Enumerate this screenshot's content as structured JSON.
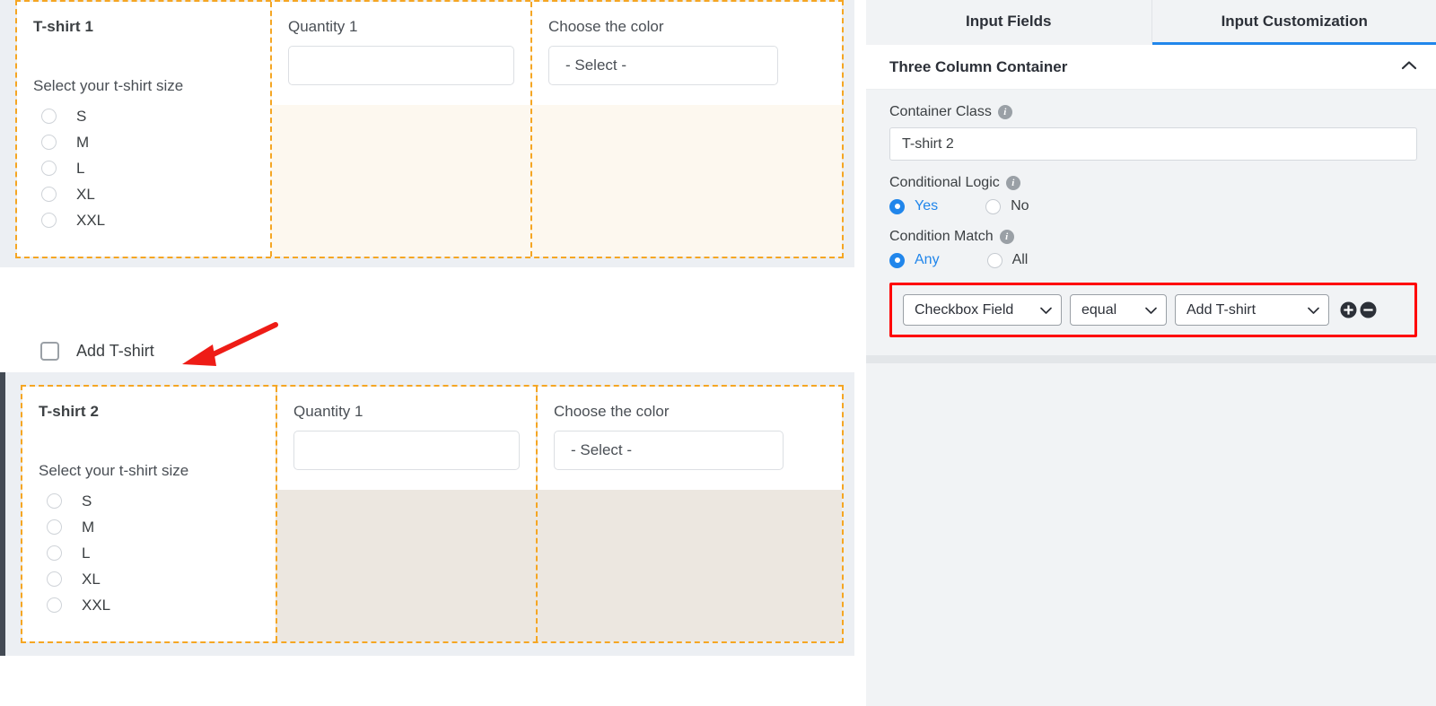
{
  "form": {
    "containers": [
      {
        "theme": "cream",
        "selected": false,
        "title": "T-shirt 1",
        "size_label": "Select your t-shirt size",
        "sizes": [
          "S",
          "M",
          "L",
          "XL",
          "XXL"
        ],
        "quantity_label": "Quantity 1",
        "quantity_value": "",
        "color_label": "Choose the color",
        "color_value": "- Select -"
      },
      {
        "theme": "beige",
        "selected": true,
        "title": "T-shirt 2",
        "size_label": "Select your t-shirt size",
        "sizes": [
          "S",
          "M",
          "L",
          "XL",
          "XXL"
        ],
        "quantity_label": "Quantity 1",
        "quantity_value": "",
        "color_label": "Choose the color",
        "color_value": "- Select -"
      }
    ],
    "add_checkbox": {
      "label": "Add T-shirt",
      "checked": false
    }
  },
  "panel": {
    "tabs": [
      {
        "label": "Input Fields",
        "active": false
      },
      {
        "label": "Input Customization",
        "active": true
      }
    ],
    "section": {
      "title": "Three Column Container",
      "collapse_icon": "chevron-up-icon"
    },
    "container_class": {
      "label": "Container Class",
      "info_icon": "info-icon",
      "value": "T-shirt 2"
    },
    "conditional_logic": {
      "label": "Conditional Logic",
      "info_icon": "info-icon",
      "options": [
        {
          "label": "Yes",
          "selected": true
        },
        {
          "label": "No",
          "selected": false
        }
      ]
    },
    "condition_match": {
      "label": "Condition Match",
      "info_icon": "info-icon",
      "options": [
        {
          "label": "Any",
          "selected": true
        },
        {
          "label": "All",
          "selected": false
        }
      ]
    },
    "condition_row": {
      "field": "Checkbox Field",
      "operator": "equal",
      "value": "Add T-shirt",
      "add_icon": "plus-circle-icon",
      "remove_icon": "minus-circle-icon",
      "highlight_color": "#ff0000"
    }
  },
  "colors": {
    "accent_blue": "#2186eb",
    "dashed_orange": "#f5a623",
    "cream_bg": "#fdf8ef",
    "beige_bg": "#ece7e0",
    "panel_bg": "#f1f3f5",
    "selected_border": "#434a54",
    "annotation_red": "#ff0000"
  }
}
